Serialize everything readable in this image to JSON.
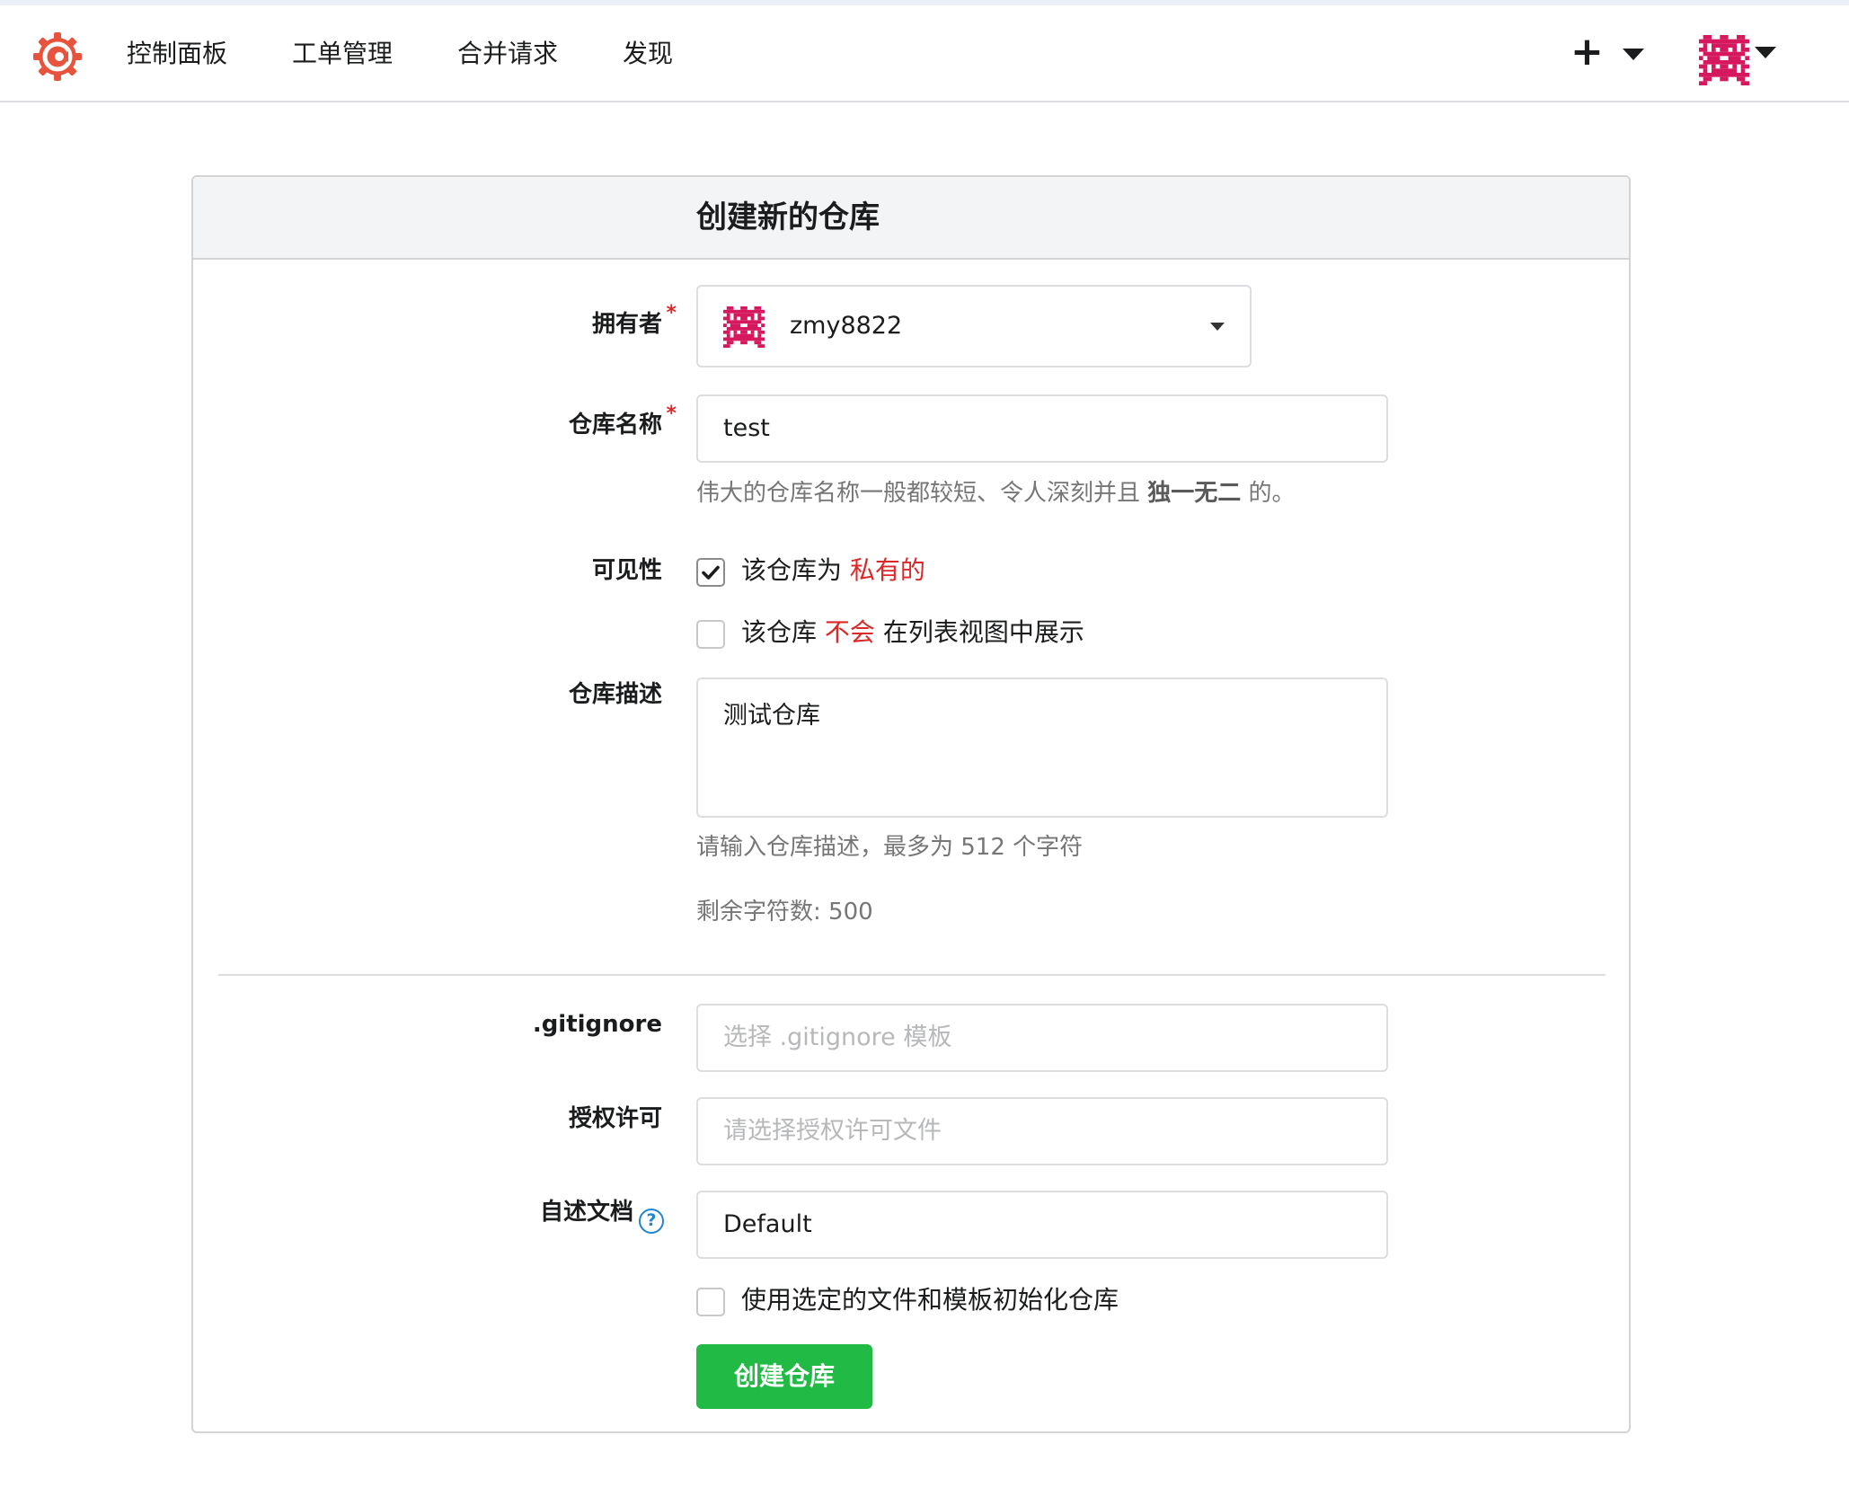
{
  "nav": {
    "items": [
      "控制面板",
      "工单管理",
      "合并请求",
      "发现"
    ],
    "plus": "+"
  },
  "form": {
    "title": "创建新的仓库",
    "owner": {
      "label": "拥有者",
      "required_mark": "*",
      "value": "zmy8822"
    },
    "repo_name": {
      "label": "仓库名称",
      "required_mark": "*",
      "value": "test",
      "help_prefix": "伟大的仓库名称一般都较短、令人深刻并且 ",
      "help_bold": "独一无二",
      "help_suffix": " 的。"
    },
    "visibility": {
      "label": "可见性",
      "private": {
        "checked": true,
        "text": "该仓库为 ",
        "highlight": "私有的"
      },
      "hidden": {
        "checked": false,
        "text_prefix": "该仓库 ",
        "highlight": "不会",
        "text_suffix": " 在列表视图中展示"
      }
    },
    "description": {
      "label": "仓库描述",
      "value": "测试仓库",
      "help": "请输入仓库描述，最多为 512 个字符",
      "remaining": "剩余字符数: 500"
    },
    "gitignore": {
      "label": ".gitignore",
      "placeholder": "选择 .gitignore 模板"
    },
    "license": {
      "label": "授权许可",
      "placeholder": "请选择授权许可文件"
    },
    "readme": {
      "label": "自述文档",
      "help_icon": "?",
      "value": "Default"
    },
    "auto_init": {
      "checked": false,
      "text": "使用选定的文件和模板初始化仓库"
    },
    "submit": "创建仓库"
  },
  "colors": {
    "accent_green": "#21ba45",
    "required_red": "#db2828",
    "help_blue": "#2185d0",
    "logo_orange": "#e8533d",
    "avatar_pink": "#d6195e"
  }
}
